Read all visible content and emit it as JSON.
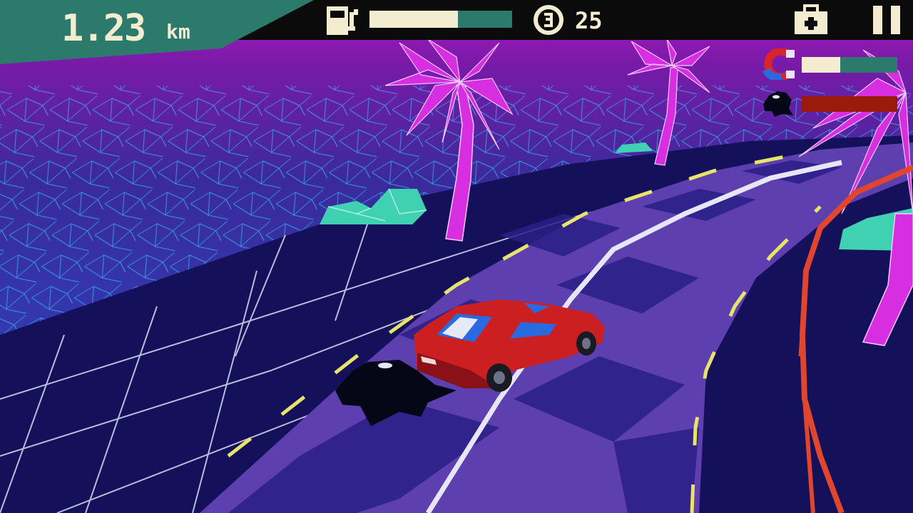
{
  "hud": {
    "distance": {
      "value": "1.23",
      "unit": "km"
    },
    "fuel": {
      "level": 0.62
    },
    "coins": {
      "count": "25"
    },
    "powerups": {
      "magnet": {
        "level": 0.4
      },
      "oil_slick": {
        "level": 1.0
      }
    },
    "icons": {
      "fuel": "fuel-pump-icon",
      "coin": "coin-icon",
      "shop": "toolbox-icon",
      "pause": "pause-icon",
      "magnet": "magnet-icon",
      "oil": "oil-slick-icon"
    }
  },
  "colors": {
    "hud_bar": "#0b0b0b",
    "hud_teal": "#2c7a6c",
    "hud_cream": "#f4ecd0",
    "oil_red": "#9a1a0c",
    "sky_top": "#b21bc8",
    "ocean": "#2d3fb8",
    "grid_line": "#35c8ff",
    "road_purple": "#5d3fb0",
    "road_dark": "#1f1a6e",
    "palm": "#d62ee0",
    "rock": "#3fd1b2",
    "car": "#cc1f22",
    "rail": "#e0452e"
  }
}
